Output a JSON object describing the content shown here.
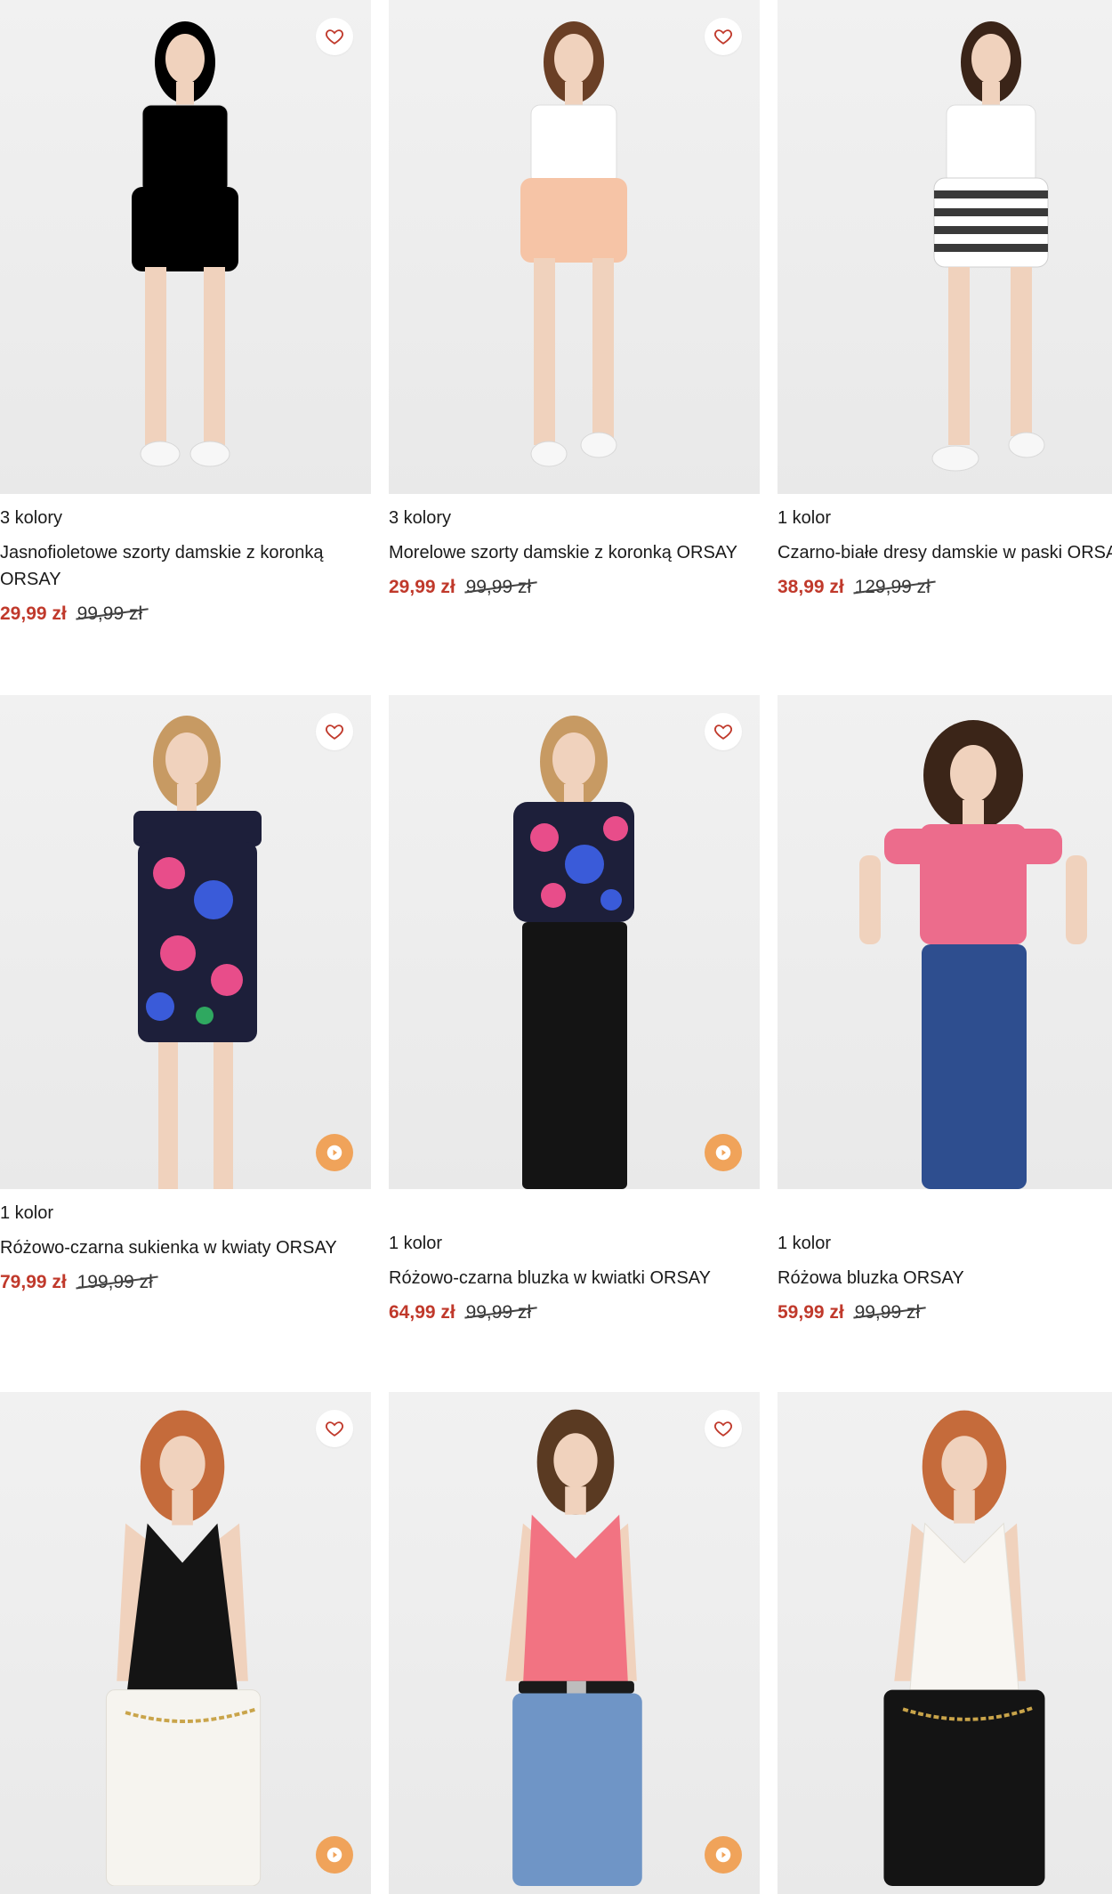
{
  "products": [
    {
      "colors": "3 kolory",
      "name": "Jasnofioletowe szorty damskie z koronką ORSAY",
      "price_new": "29,99 zł",
      "price_old": "99,99 zł",
      "garment": "#b4a5e6",
      "top": "#ffffff",
      "hair": "#7a4a2a",
      "has_video": false
    },
    {
      "colors": "3 kolory",
      "name": "Morelowe szorty damskie z koronką ORSAY",
      "price_new": "29,99 zł",
      "price_old": "99,99 zł",
      "garment": "#f6c4a6",
      "top": "#ffffff",
      "hair": "#6a3f25",
      "has_video": false
    },
    {
      "colors": "1 kolor",
      "name": "Czarno-białe dresy damskie w paski ORSAY",
      "price_new": "38,99 zł",
      "price_old": "129,99 zł",
      "garment": "#4a4a4a",
      "top": "#ffffff",
      "hair": "#3a2418",
      "has_video": false
    },
    {
      "colors": "1 kolor",
      "name": "Różowo-czarna sukienka w kwiaty ORSAY",
      "price_new": "79,99 zł",
      "price_old": "199,99 zł",
      "garment": "#1d1f3a",
      "top": "#1d1f3a",
      "hair": "#c79a63",
      "has_video": true
    },
    {
      "colors": "1 kolor",
      "name": "Różowo-czarna bluzka w kwiatki ORSAY",
      "price_new": "64,99 zł",
      "price_old": "99,99 zł",
      "garment": "#141414",
      "top": "#1d1f3a",
      "hair": "#c79a63",
      "has_video": true
    },
    {
      "colors": "1 kolor",
      "name": "Różowa bluzka ORSAY",
      "price_new": "59,99 zł",
      "price_old": "99,99 zł",
      "garment": "#2e4e8f",
      "top": "#ec6c8c",
      "hair": "#3b2518",
      "has_video": false
    },
    {
      "colors": "",
      "name": "",
      "price_new": "",
      "price_old": "",
      "garment": "#f6f4ef",
      "top": "#141414",
      "hair": "#c56b3b",
      "has_video": true
    },
    {
      "colors": "",
      "name": "",
      "price_new": "",
      "price_old": "",
      "garment": "#6f95c6",
      "top": "#f27382",
      "hair": "#5a3a22",
      "has_video": true
    },
    {
      "colors": "",
      "name": "",
      "price_new": "",
      "price_old": "",
      "garment": "#141414",
      "top": "#f8f6f2",
      "hair": "#c56b3b",
      "has_video": true
    }
  ],
  "colors": {
    "price_accent": "#c0392b",
    "play_accent": "#f0a35a",
    "heart_accent": "#c0392b"
  },
  "icons": {
    "favorite": "heart-icon",
    "video": "play-icon"
  }
}
